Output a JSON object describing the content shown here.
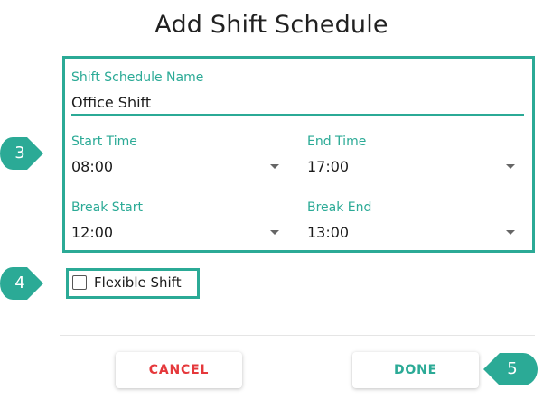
{
  "dialog": {
    "title": "Add Shift Schedule"
  },
  "form": {
    "schedule_name": {
      "label": "Shift Schedule Name",
      "value": "Office Shift"
    },
    "start_time": {
      "label": "Start Time",
      "value": "08:00"
    },
    "end_time": {
      "label": "End Time",
      "value": "17:00"
    },
    "break_start": {
      "label": "Break Start",
      "value": "12:00"
    },
    "break_end": {
      "label": "Break End",
      "value": "13:00"
    },
    "flexible_shift": {
      "label": "Flexible Shift",
      "checked": false
    }
  },
  "actions": {
    "cancel_label": "CANCEL",
    "done_label": "DONE"
  },
  "callouts": {
    "fields": "3",
    "checkbox": "4",
    "done": "5"
  },
  "colors": {
    "accent": "#2baa96",
    "cancel": "#e5383b"
  }
}
